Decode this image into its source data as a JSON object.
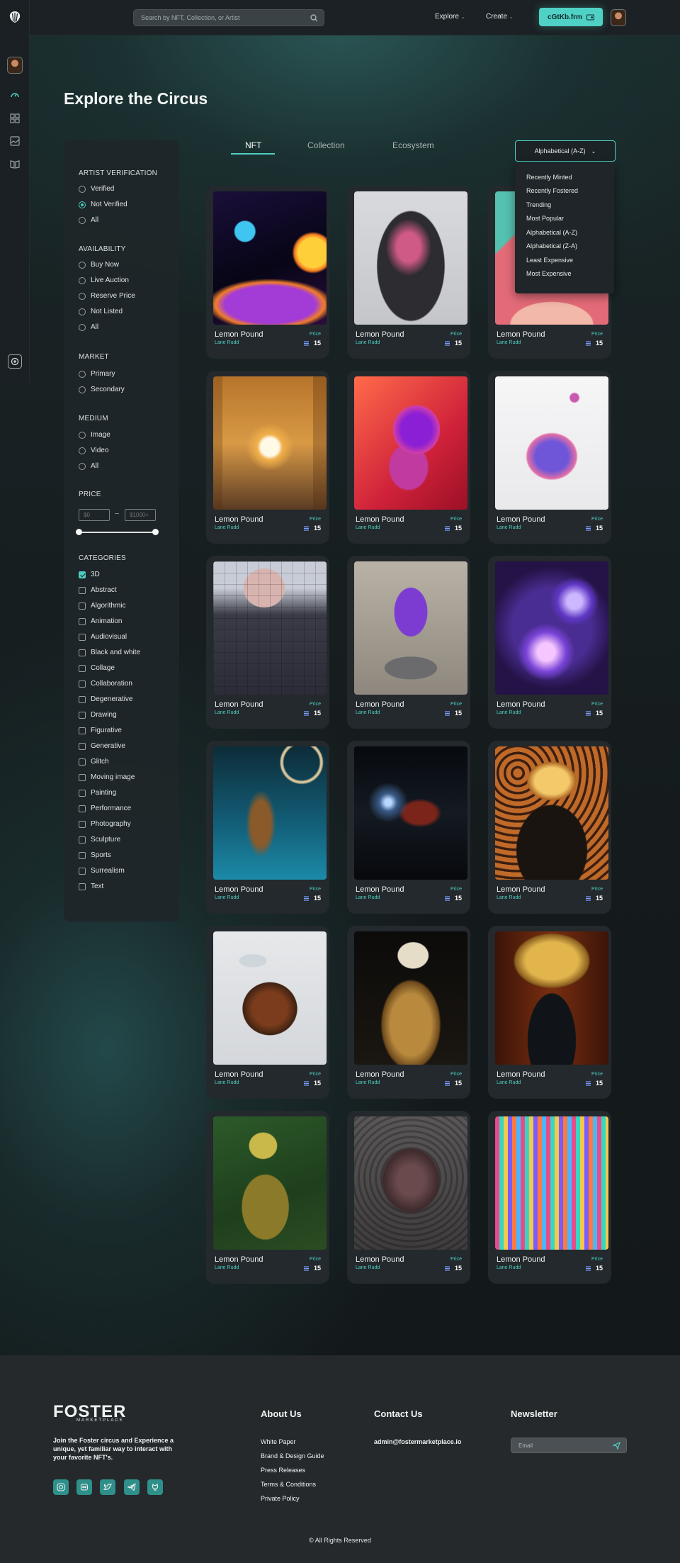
{
  "header": {
    "search_placeholder": "Search by NFT, Collection, or Artist",
    "nav": {
      "explore": "Explore",
      "create": "Create"
    },
    "wallet_label": "cGtKb.frm"
  },
  "page": {
    "title": "Explore the Circus"
  },
  "filters": {
    "artist_verification": {
      "title": "ARTIST VERIFICATION",
      "options": [
        "Verified",
        "Not Verified",
        "All"
      ],
      "selected": "Not Verified"
    },
    "availability": {
      "title": "AVAILABILITY",
      "options": [
        "Buy Now",
        "Live Auction",
        "Reserve Price",
        "Not Listed",
        "All"
      ]
    },
    "market": {
      "title": "MARKET",
      "options": [
        "Primary",
        "Secondary"
      ]
    },
    "medium": {
      "title": "MEDIUM",
      "options": [
        "Image",
        "Video",
        "All"
      ]
    },
    "price": {
      "title": "PRICE",
      "min_placeholder": "$0",
      "max_placeholder": "$1000+"
    },
    "categories": {
      "title": "CATEGORIES",
      "checked": "3D",
      "options": [
        "3D",
        "Abstract",
        "Algorithmic",
        "Animation",
        "Audiovisual",
        "Black and white",
        "Collage",
        "Collaboration",
        "Degenerative",
        "Drawing",
        "Figurative",
        "Generative",
        "Glitch",
        "Moving image",
        "Painting",
        "Performance",
        "Photography",
        "Sculpture",
        "Sports",
        "Surrealism",
        "Text"
      ]
    }
  },
  "tabs": [
    "NFT",
    "Collection",
    "Ecosystem"
  ],
  "active_tab": "NFT",
  "sort": {
    "selected": "Alphabetical (A-Z)",
    "options": [
      "Recently Minted",
      "Recently Fostered",
      "Trending",
      "Most Popular",
      "Alphabetical (A-Z)",
      "Alphabetical (Z-A)",
      "Least Expensive",
      "Most Expensive"
    ]
  },
  "cards": [
    {
      "name": "Lemon Pound",
      "artist": "Lane Rudd",
      "price_label": "Price",
      "price": "15",
      "art": "surreal-planets"
    },
    {
      "name": "Lemon Pound",
      "artist": "Lane Rudd",
      "price_label": "Price",
      "price": "15",
      "art": "painted-head"
    },
    {
      "name": "Lemon Pound",
      "artist": "Lane Rudd",
      "price_label": "Price",
      "price": "15",
      "art": "pink-abstract"
    },
    {
      "name": "Lemon Pound",
      "artist": "Lane Rudd",
      "price_label": "Price",
      "price": "15",
      "art": "desert-sun"
    },
    {
      "name": "Lemon Pound",
      "artist": "Lane Rudd",
      "price_label": "Price",
      "price": "15",
      "art": "purple-swirl"
    },
    {
      "name": "Lemon Pound",
      "artist": "Lane Rudd",
      "price_label": "Price",
      "price": "15",
      "art": "liquid-splash"
    },
    {
      "name": "Lemon Pound",
      "artist": "Lane Rudd",
      "price_label": "Price",
      "price": "15",
      "art": "pixel-portrait"
    },
    {
      "name": "Lemon Pound",
      "artist": "Lane Rudd",
      "price_label": "Price",
      "price": "15",
      "art": "purple-sculpture"
    },
    {
      "name": "Lemon Pound",
      "artist": "Lane Rudd",
      "price_label": "Price",
      "price": "15",
      "art": "glass-spheres"
    },
    {
      "name": "Lemon Pound",
      "artist": "Lane Rudd",
      "price_label": "Price",
      "price": "15",
      "art": "golden-branches"
    },
    {
      "name": "Lemon Pound",
      "artist": "Lane Rudd",
      "price_label": "Price",
      "price": "15",
      "art": "dark-corridor"
    },
    {
      "name": "Lemon Pound",
      "artist": "Lane Rudd",
      "price_label": "Price",
      "price": "15",
      "art": "astronaut"
    },
    {
      "name": "Lemon Pound",
      "artist": "Lane Rudd",
      "price_label": "Price",
      "price": "15",
      "art": "bitten-fruit"
    },
    {
      "name": "Lemon Pound",
      "artist": "Lane Rudd",
      "price_label": "Price",
      "price": "15",
      "art": "golden-skull"
    },
    {
      "name": "Lemon Pound",
      "artist": "Lane Rudd",
      "price_label": "Price",
      "price": "15",
      "art": "golden-wings"
    },
    {
      "name": "Lemon Pound",
      "artist": "Lane Rudd",
      "price_label": "Price",
      "price": "15",
      "art": "citrus-poster"
    },
    {
      "name": "Lemon Pound",
      "artist": "Lane Rudd",
      "price_label": "Price",
      "price": "15",
      "art": "rose-heart"
    },
    {
      "name": "Lemon Pound",
      "artist": "Lane Rudd",
      "price_label": "Price",
      "price": "15",
      "art": "glitch-colors"
    }
  ],
  "footer": {
    "logo_text": "FOSTER",
    "logo_sub": "MARKETPLACE",
    "tagline": "Join the Foster circus and Experience a unique, yet familiar way to interact with your favorite NFT's.",
    "about": {
      "title": "About Us",
      "links": [
        "White Paper",
        "Brand & Design Guide",
        "Press Releases",
        "Terms & Conditions",
        "Private Policy"
      ]
    },
    "contact": {
      "title": "Contact Us",
      "email": "admin@fostermarketplace.io"
    },
    "newsletter": {
      "title": "Newsletter",
      "placeholder": "Email"
    },
    "social_icons": [
      "instagram-icon",
      "discord-icon",
      "twitter-icon",
      "telegram-icon",
      "github-icon"
    ],
    "copyright": "© All Rights Reserved"
  },
  "colors": {
    "accent": "#4fd1c5",
    "background": "#14191b",
    "card": "#23292c",
    "footer": "#25292c"
  }
}
